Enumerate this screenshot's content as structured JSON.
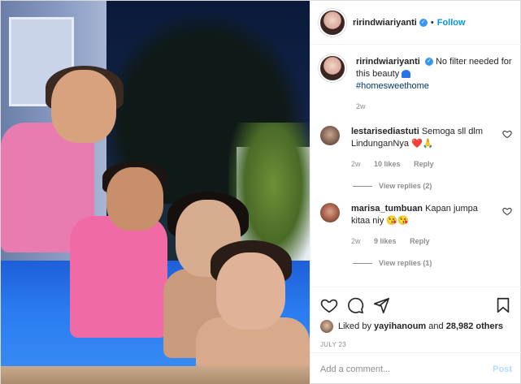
{
  "post": {
    "username": "ririndwiariyanti",
    "follow_label": "Follow",
    "dot": "•",
    "caption_text": "No filter needed for this beauty",
    "hashtag": "#homesweethome",
    "caption_age": "2w"
  },
  "comments": [
    {
      "username": "lestarisediastuti",
      "text": "Semoga sll dlm LindunganNya",
      "emoji": "❤️🙏",
      "age": "2w",
      "likes": "10 likes",
      "reply_label": "Reply",
      "view_replies": "View replies (2)"
    },
    {
      "username": "marisa_tumbuan",
      "text": "Kapan jumpa kitaa niy",
      "emoji": "😘😘",
      "age": "2w",
      "likes": "9 likes",
      "reply_label": "Reply",
      "view_replies": "View replies (1)"
    }
  ],
  "engagement": {
    "liked_by": "yayihanoum",
    "and_label": "and",
    "others": "28,982 others",
    "date": "JULY 23"
  },
  "add_comment": {
    "placeholder": "Add a comment...",
    "post_label": "Post"
  },
  "icons": {
    "like": "heart-icon",
    "comment": "comment-icon",
    "share": "share-icon",
    "save": "bookmark-icon",
    "verified": "verified-badge-icon"
  },
  "colors": {
    "link_blue": "#0095f6",
    "verified_blue": "#3897f0",
    "muted": "#8e8e8e",
    "post_disabled": "#b2dffc"
  }
}
